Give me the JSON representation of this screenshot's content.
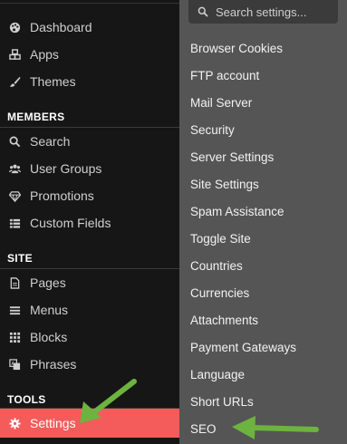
{
  "sidebar": {
    "top_items": [
      {
        "label": "Dashboard",
        "icon": "palette-icon"
      },
      {
        "label": "Apps",
        "icon": "cubes-icon"
      },
      {
        "label": "Themes",
        "icon": "brush-icon"
      }
    ],
    "members": {
      "heading": "MEMBERS",
      "items": [
        {
          "label": "Search",
          "icon": "search-icon"
        },
        {
          "label": "User Groups",
          "icon": "users-icon"
        },
        {
          "label": "Promotions",
          "icon": "diamond-icon"
        },
        {
          "label": "Custom Fields",
          "icon": "list-icon"
        }
      ]
    },
    "site": {
      "heading": "SITE",
      "items": [
        {
          "label": "Pages",
          "icon": "file-icon"
        },
        {
          "label": "Menus",
          "icon": "menu-icon"
        },
        {
          "label": "Blocks",
          "icon": "grid-icon"
        },
        {
          "label": "Phrases",
          "icon": "translate-icon"
        }
      ]
    },
    "tools": {
      "heading": "TOOLS",
      "items": [
        {
          "label": "Settings",
          "icon": "gear-icon",
          "active": true
        }
      ]
    }
  },
  "dropdown": {
    "search_placeholder": "Search settings...",
    "items": [
      "Browser Cookies",
      "FTP account",
      "Mail Server",
      "Security",
      "Server Settings",
      "Site Settings",
      "Spam Assistance",
      "Toggle Site",
      "Countries",
      "Currencies",
      "Attachments",
      "Payment Gateways",
      "Language",
      "Short URLs",
      "SEO"
    ]
  },
  "colors": {
    "sidebar_bg": "#161616",
    "panel_bg": "#555555",
    "active_bg": "#f45b5b",
    "arrow": "#6db33f"
  }
}
